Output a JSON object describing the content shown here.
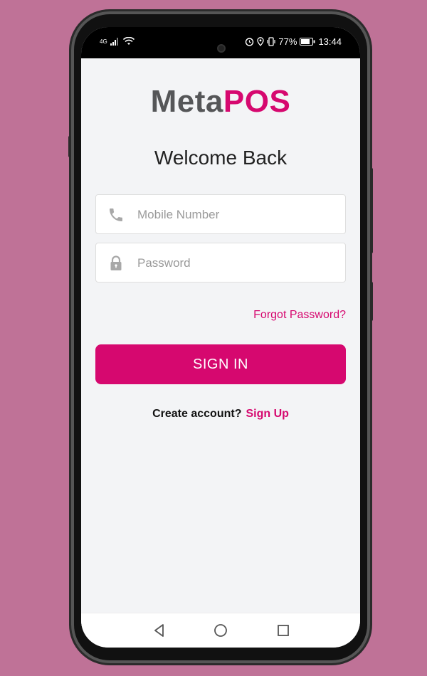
{
  "status_bar": {
    "signal": "4G",
    "battery_percent": "77%",
    "time": "13:44"
  },
  "logo": {
    "part1": "Meta",
    "part2": "POS"
  },
  "title": "Welcome Back",
  "mobile_field": {
    "placeholder": "Mobile Number",
    "value": ""
  },
  "password_field": {
    "placeholder": "Password",
    "value": ""
  },
  "forgot_password": "Forgot Password?",
  "sign_in_button": "SIGN IN",
  "create_account": {
    "prompt": "Create account?",
    "link": "Sign Up"
  },
  "colors": {
    "brand": "#d6086f",
    "background": "#bf7297",
    "screen": "#f3f4f6"
  },
  "icons": {
    "mobile": "phone-icon",
    "password": "lock-icon",
    "nav_back": "back-triangle-icon",
    "nav_home": "home-circle-icon",
    "nav_recent": "recents-square-icon"
  }
}
